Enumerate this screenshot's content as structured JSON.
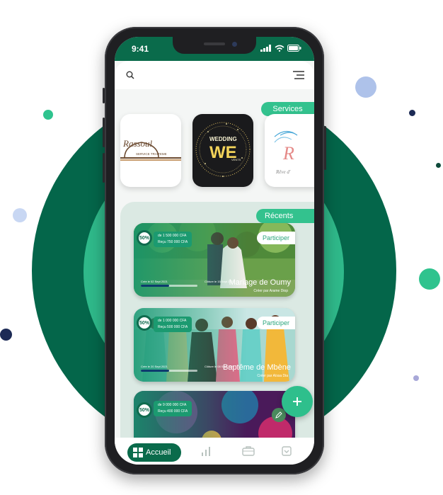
{
  "status_bar": {
    "time": "9:41"
  },
  "services": {
    "label": "Services",
    "items": [
      {
        "name": "Rassoul",
        "subtitle": "SERVICE TRAITEME"
      },
      {
        "name": "WEDDING",
        "mark": "WE",
        "suffix": "VENTS"
      },
      {
        "name": "R",
        "subtitle": "Rêve d'"
      }
    ]
  },
  "recents": {
    "label": "Récents",
    "events": [
      {
        "percent": "50%",
        "goal": "de 1 500 000 CFA",
        "received": "Reçu 750 000 CFA",
        "participate_label": "Participer",
        "title": "Mariage de Oumy",
        "creator": "Créer par Arame Diop",
        "start_date": "Crée le 02 Sept 2021",
        "end_date": "Clôture le 15 Sept 2021",
        "progress": 0.5
      },
      {
        "percent": "50%",
        "goal": "de 1 000 000 CFA",
        "received": "Reçu 500 000 CFA",
        "participate_label": "Participer",
        "title": "Baptême de Mbène",
        "creator": "Créer par Aïssa Dia",
        "start_date": "Crée le 20 Sept 2021",
        "end_date": "Clôture le 08 Sept 2021",
        "progress": 0.5
      },
      {
        "percent": "50%",
        "goal": "de 9 000 000 CFA",
        "received": "Reçu 400 000 CFA",
        "progress": 0.5
      }
    ]
  },
  "nav": {
    "active_label": "Accueil",
    "items": [
      "grid-icon",
      "chart-icon",
      "briefcase-icon",
      "inbox-icon"
    ]
  },
  "colors": {
    "brand_dark": "#0a6b4b",
    "brand_light": "#33c28e",
    "panel": "#dbe9e3"
  }
}
